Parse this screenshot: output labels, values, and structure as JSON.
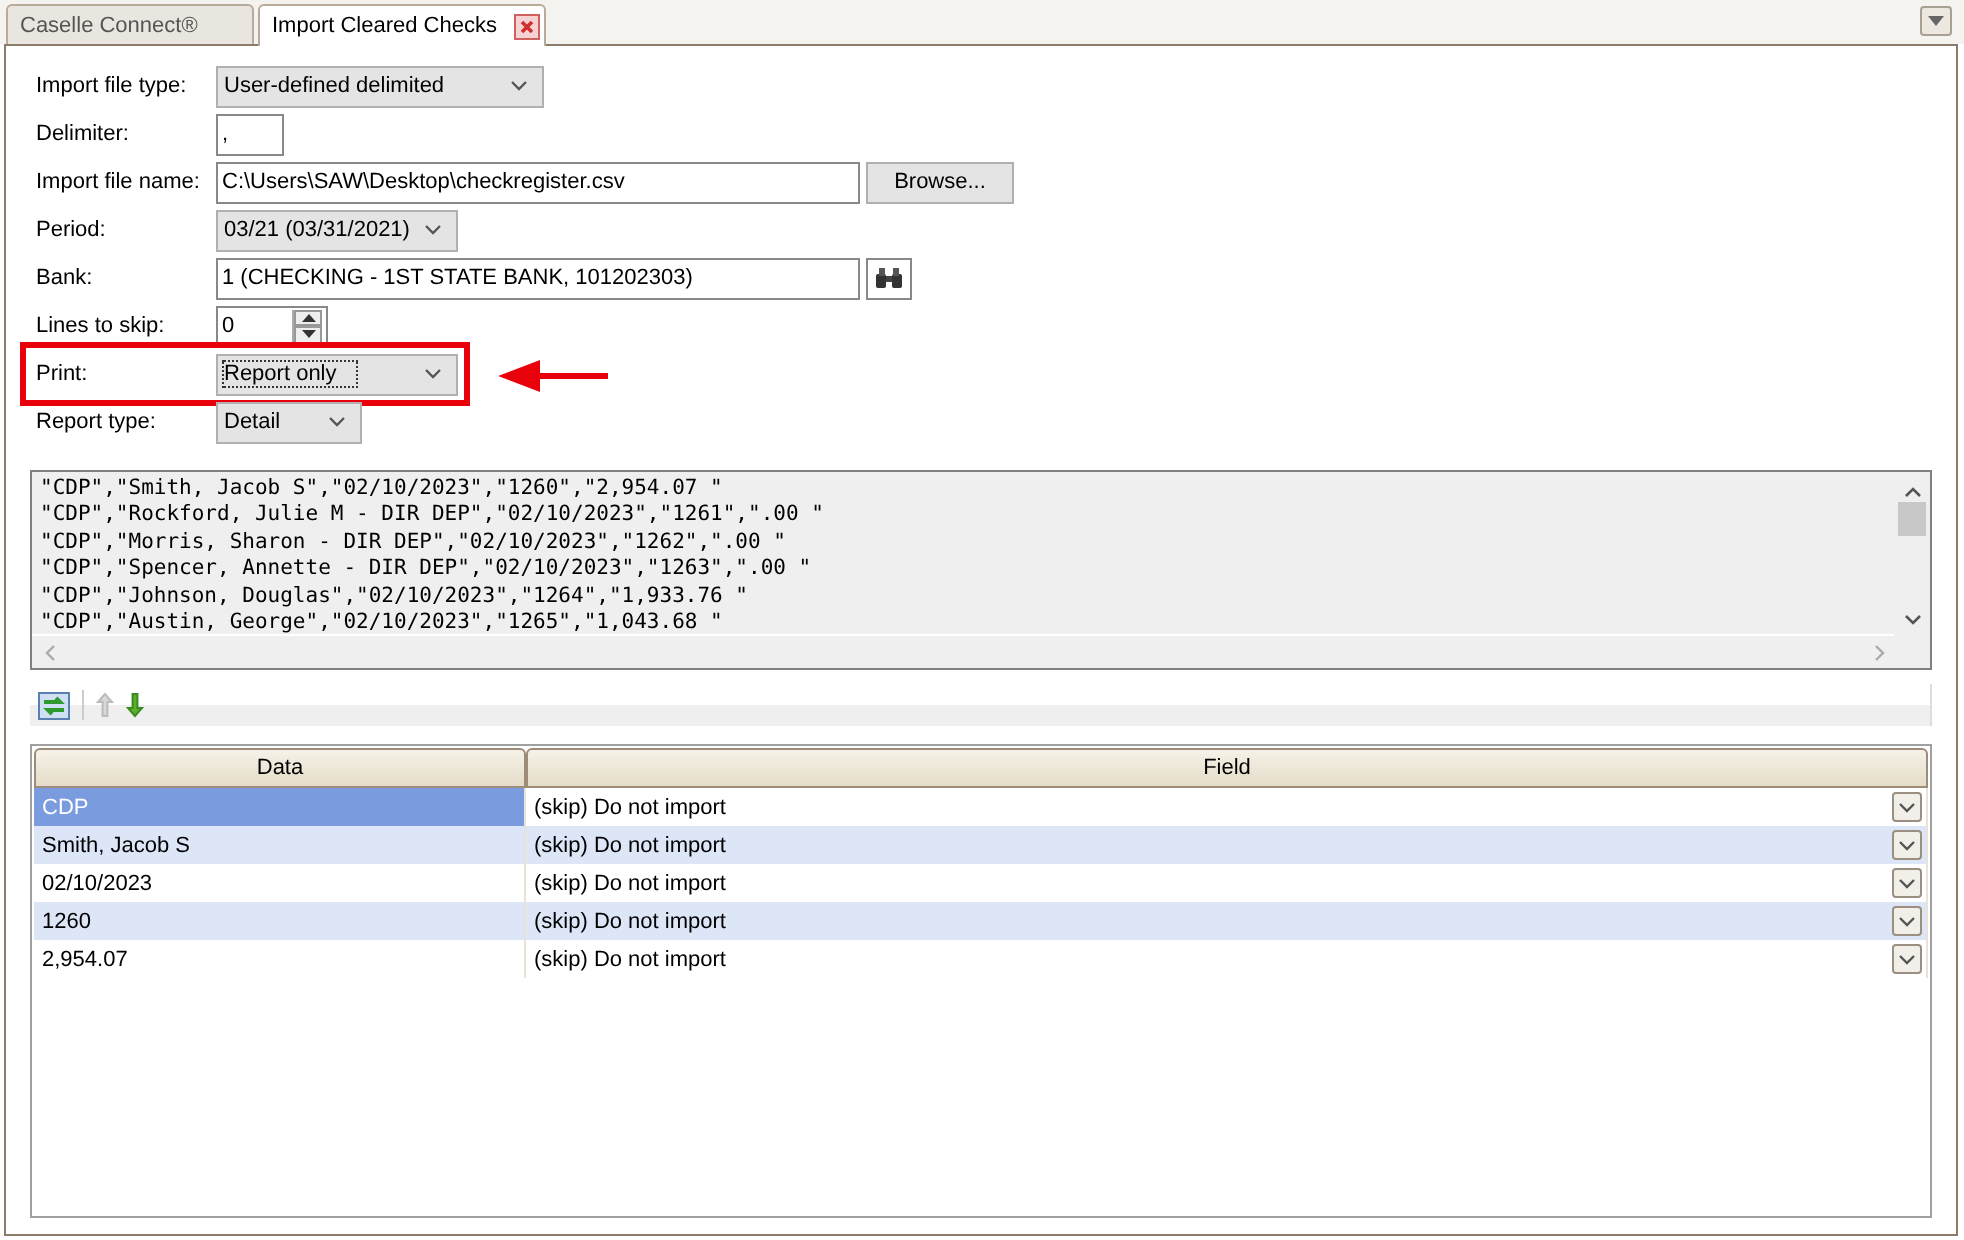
{
  "tabs": [
    {
      "label": "Caselle Connect®",
      "selected": false,
      "closable": false
    },
    {
      "label": "Import Cleared Checks",
      "selected": true,
      "closable": true
    }
  ],
  "form": [
    {
      "kind": "dropdown",
      "label": "Import file type:",
      "value": "User-defined delimited"
    },
    {
      "kind": "text",
      "label": "Delimiter:",
      "value": ","
    },
    {
      "kind": "file",
      "label": "Import file name:",
      "value": "C:\\Users\\SAW\\Desktop\\checkregister.csv",
      "button": "Browse..."
    },
    {
      "kind": "dropdown",
      "label": "Period:",
      "value": "03/21 (03/31/2021)"
    },
    {
      "kind": "lookup",
      "label": "Bank:",
      "value": "1 (CHECKING - 1ST STATE BANK, 101202303)"
    },
    {
      "kind": "spinner",
      "label": "Lines to skip:",
      "value": "0"
    },
    {
      "kind": "dropdown",
      "label": "Print:",
      "value": "Report only",
      "highlighted": true
    },
    {
      "kind": "dropdown",
      "label": "Report type:",
      "value": "Detail"
    }
  ],
  "preview_lines": [
    "\"CDP\",\"Smith, Jacob S\",\"02/10/2023\",\"1260\",\"2,954.07 \"",
    "\"CDP\",\"Rockford, Julie M - DIR DEP\",\"02/10/2023\",\"1261\",\".00 \"",
    "\"CDP\",\"Morris, Sharon - DIR DEP\",\"02/10/2023\",\"1262\",\".00 \"",
    "\"CDP\",\"Spencer, Annette - DIR DEP\",\"02/10/2023\",\"1263\",\".00 \"",
    "\"CDP\",\"Johnson, Douglas\",\"02/10/2023\",\"1264\",\"1,933.76 \"",
    "\"CDP\",\"Austin, George\",\"02/10/2023\",\"1265\",\"1,043.68 \""
  ],
  "table": {
    "columns": [
      "Data",
      "Field"
    ],
    "rows": [
      {
        "data": "CDP",
        "field": "(skip) Do not import",
        "selected": true
      },
      {
        "data": "Smith, Jacob S",
        "field": "(skip) Do not import",
        "selected": false
      },
      {
        "data": "02/10/2023",
        "field": "(skip) Do not import",
        "selected": false
      },
      {
        "data": "1260",
        "field": "(skip) Do not import",
        "selected": false
      },
      {
        "data": "2,954.07",
        "field": "(skip) Do not import",
        "selected": false
      }
    ]
  }
}
